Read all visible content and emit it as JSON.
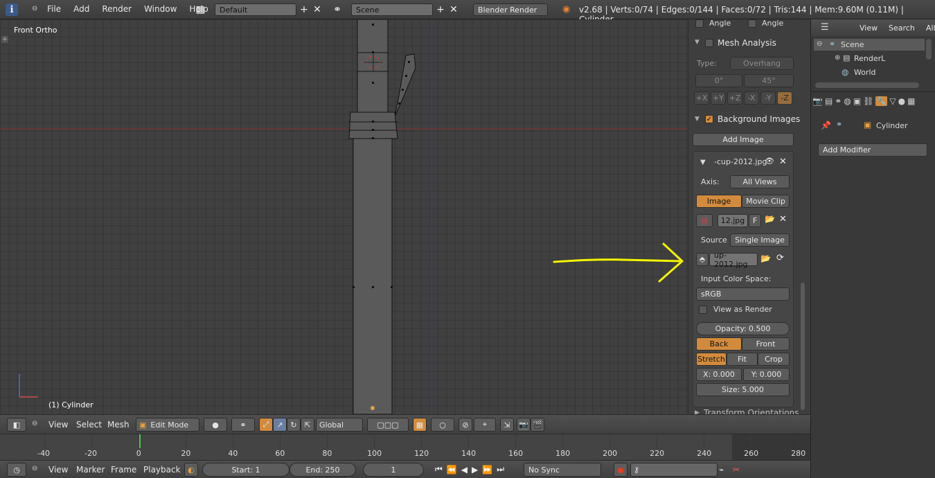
{
  "topbar": {
    "menus": [
      "File",
      "Add",
      "Render",
      "Window",
      "Help"
    ],
    "layout": "Default",
    "scene": "Scene",
    "engine": "Blender Render",
    "stats": "v2.68 | Verts:0/74 | Edges:0/144 | Faces:0/72 | Tris:144 | Mem:9.60M (0.11M) | Cylinder"
  },
  "viewport": {
    "view_label": "Front Ortho",
    "object_label": "(1) Cylinder"
  },
  "npanel": {
    "angle1": "Angle",
    "angle2": "Angle",
    "mesh_analysis": "Mesh Analysis",
    "type_label": "Type:",
    "type_value": "Overhang",
    "deg0": "0°",
    "deg45": "45°",
    "axes": [
      "+X",
      "+Y",
      "+Z",
      "-X",
      "-Y",
      "-Z"
    ],
    "bg_images": "Background Images",
    "add_image": "Add Image",
    "image_name": "-cup-2012.jpg",
    "axis_label": "Axis:",
    "axis_value": "All Views",
    "tab_image": "Image",
    "tab_movie": "Movie Clip",
    "file_short": "12.jpg",
    "f_btn": "F",
    "source_label": "Source",
    "source_value": "Single Image",
    "file_path": "up-2012.jpg",
    "input_cs": "Input Color Space:",
    "cs_value": "sRGB",
    "view_as_render": "View as Render",
    "opacity_label": "Opacity:",
    "opacity_value": "0.500",
    "back": "Back",
    "front": "Front",
    "stretch": "Stretch",
    "fit": "Fit",
    "crop": "Crop",
    "x_label": "X:",
    "x_value": "0.000",
    "y_label": "Y:",
    "y_value": "0.000",
    "size_label": "Size:",
    "size_value": "5.000",
    "transform_orient": "Transform Orientations"
  },
  "outliner": {
    "view": "View",
    "search": "Search",
    "all": "All",
    "items": [
      "Scene",
      "RenderL",
      "World"
    ]
  },
  "props": {
    "object": "Cylinder",
    "add_modifier": "Add Modifier"
  },
  "vheader": {
    "view": "View",
    "select": "Select",
    "mesh": "Mesh",
    "mode": "Edit Mode",
    "orientation": "Global"
  },
  "timeline": {
    "ticks": [
      "-40",
      "-20",
      "0",
      "20",
      "40",
      "60",
      "80",
      "100",
      "120",
      "140",
      "160",
      "180",
      "200",
      "220",
      "240",
      "260",
      "280"
    ],
    "view": "View",
    "marker": "Marker",
    "frame": "Frame",
    "playback": "Playback",
    "start": "Start: 1",
    "end": "End: 250",
    "current": "1",
    "sync": "No Sync"
  },
  "colors": {
    "accent": "#d28b3d",
    "arrow": "#f5f500"
  }
}
